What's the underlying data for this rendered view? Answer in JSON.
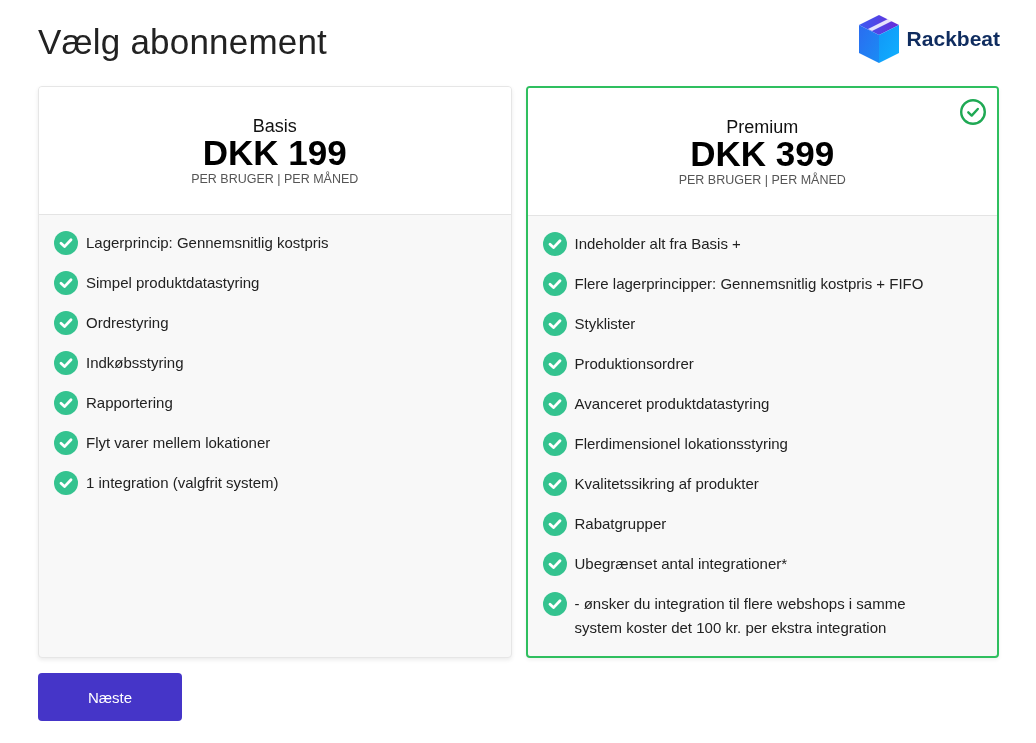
{
  "page": {
    "title": "Vælg abonnement"
  },
  "logo": {
    "name": "Rackbeat"
  },
  "plans": [
    {
      "name": "Basis",
      "price": "DKK 199",
      "unit": "PER BRUGER | PER MÅNED",
      "selected": false,
      "features": [
        "Lagerprincip: Gennemsnitlig kostpris",
        "Simpel produktdatastyring",
        "Ordrestyring",
        "Indkøbsstyring",
        "Rapportering",
        "Flyt varer mellem lokationer",
        "1 integration (valgfrit system)"
      ]
    },
    {
      "name": "Premium",
      "price": "DKK 399",
      "unit": "PER BRUGER | PER MÅNED",
      "selected": true,
      "features": [
        "Indeholder alt fra Basis +",
        "Flere lagerprincipper: Gennemsnitlig kostpris + FIFO",
        "Styklister",
        "Produktionsordrer",
        "Avanceret produktdatastyring",
        "Flerdimensionel lokationsstyring",
        "Kvalitetssikring af produkter",
        "Rabatgrupper",
        "Ubegrænset antal integrationer*",
        "- ønsker du integration til flere webshops i samme system koster det 100 kr. per ekstra integration"
      ]
    }
  ],
  "next_button": {
    "label": "Næste"
  }
}
